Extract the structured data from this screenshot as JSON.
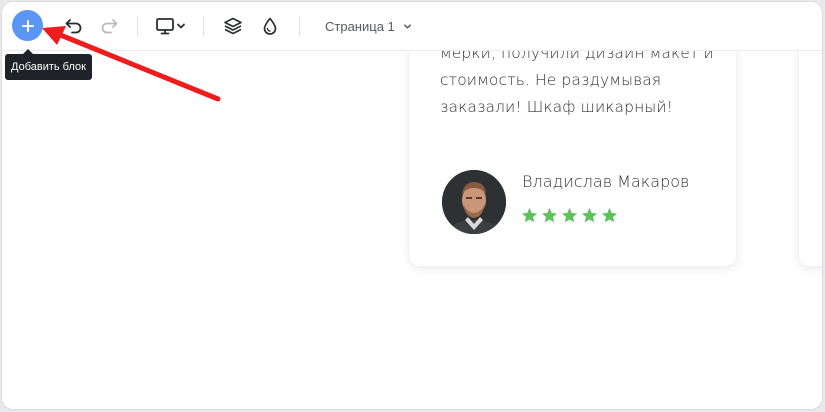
{
  "toolbar": {
    "add_button_tooltip": "Добавить блок",
    "page_select_label": "Страница 1",
    "accent_color": "#5b96f7"
  },
  "review": {
    "text_lines": [
      "мерки, получили дизайн макет и",
      "стоимость. Не раздумывая",
      "заказали! Шкаф шикарный!"
    ],
    "author": "Владислав Макаров",
    "rating": 5,
    "rating_max": 5,
    "star_color": "#5cc35c"
  },
  "annotation": {
    "arrow_color": "#ee1c1c"
  },
  "icons": {
    "add": "plus-icon",
    "undo": "undo-icon",
    "redo": "redo-icon",
    "device": "desktop-icon",
    "device_menu": "chevron-down-icon",
    "layers": "layers-icon",
    "theme": "drop-icon",
    "page_menu": "chevron-down-icon"
  }
}
